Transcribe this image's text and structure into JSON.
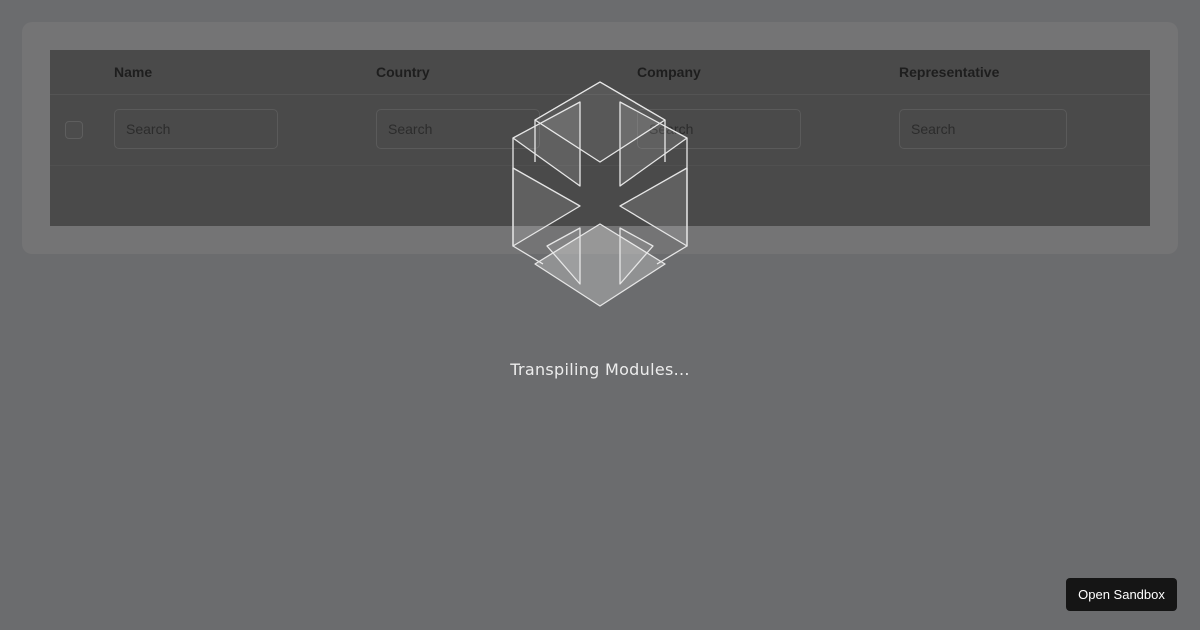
{
  "table": {
    "columns": [
      {
        "label": "Name"
      },
      {
        "label": "Country"
      },
      {
        "label": "Company"
      },
      {
        "label": "Representative"
      }
    ],
    "filters": {
      "name_placeholder": "Search",
      "country_placeholder": "Search",
      "company_placeholder": "Search",
      "representative_placeholder": "Search"
    }
  },
  "loader": {
    "icon": "codesandbox-cube-icon",
    "message": "Transpiling Modules..."
  },
  "footer": {
    "open_sandbox_label": "Open Sandbox"
  },
  "colors": {
    "backdrop": "#6b6c6e",
    "table_bg": "#4a4a4a",
    "button_bg": "#151515",
    "text_light": "#ececec"
  }
}
